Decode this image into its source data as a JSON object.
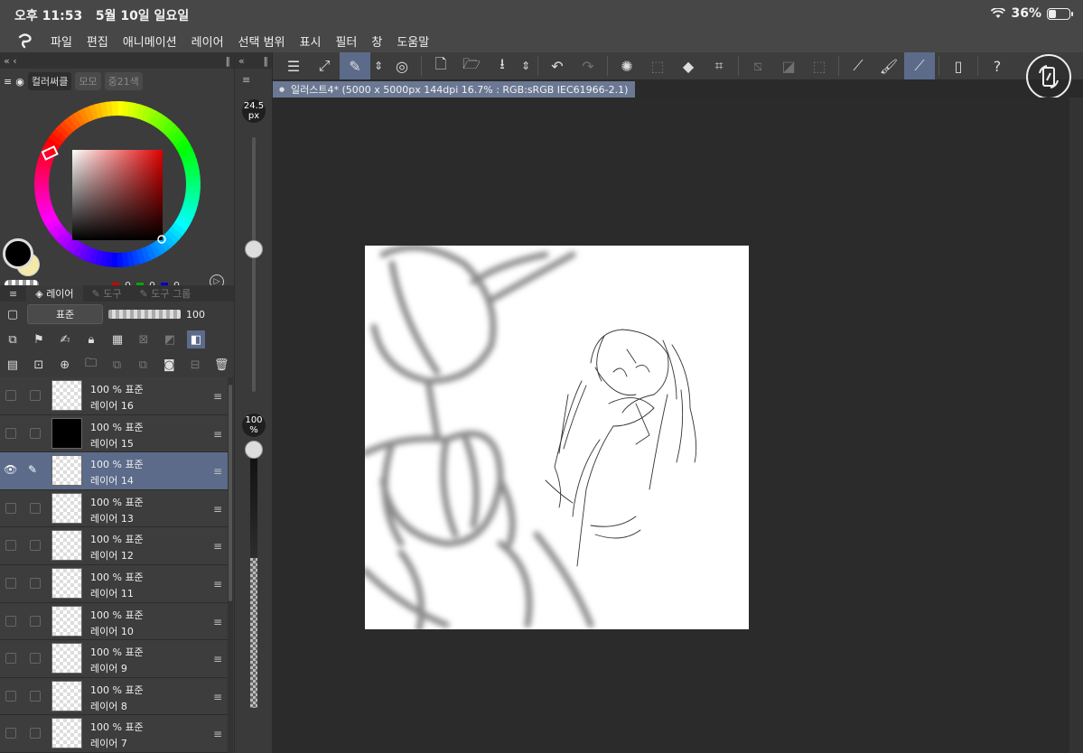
{
  "status": {
    "time": "오후 11:53",
    "date": "5월 10일 일요일",
    "battery_text": "36%",
    "battery_level": 0.36
  },
  "menu": {
    "items": [
      "파일",
      "편집",
      "애니메이션",
      "레이어",
      "선택 범위",
      "표시",
      "필터",
      "창",
      "도움말"
    ]
  },
  "color_panel": {
    "tabs": [
      "컬러써클",
      "모모",
      "중21색"
    ],
    "r": "0",
    "g": "0",
    "b": "0",
    "main_color": "#000000",
    "sub_color": "#f5e9a8"
  },
  "layer_panel": {
    "tabs": [
      "레이어",
      "도구",
      "도구 그룹"
    ],
    "blend_mode": "표준",
    "opacity": "100",
    "layers": [
      {
        "mode": "100 % 표준",
        "name": "레이어 16",
        "thumb": "checker",
        "selected": false,
        "visible_icons": false
      },
      {
        "mode": "100 % 표준",
        "name": "레이어 15",
        "thumb": "black",
        "selected": false,
        "visible_icons": false
      },
      {
        "mode": "100 % 표준",
        "name": "레이어 14",
        "thumb": "checker",
        "selected": true,
        "visible_icons": true
      },
      {
        "mode": "100 % 표준",
        "name": "레이어 13",
        "thumb": "checker",
        "selected": false,
        "visible_icons": false
      },
      {
        "mode": "100 % 표준",
        "name": "레이어 12",
        "thumb": "checker",
        "selected": false,
        "visible_icons": false
      },
      {
        "mode": "100 % 표준",
        "name": "레이어 11",
        "thumb": "checker",
        "selected": false,
        "visible_icons": false
      },
      {
        "mode": "100 % 표준",
        "name": "레이어 10",
        "thumb": "checker",
        "selected": false,
        "visible_icons": false
      },
      {
        "mode": "100 % 표준",
        "name": "레이어 9",
        "thumb": "checker",
        "selected": false,
        "visible_icons": false
      },
      {
        "mode": "100 % 표준",
        "name": "레이어 8",
        "thumb": "checker",
        "selected": false,
        "visible_icons": false
      },
      {
        "mode": "100 % 표준",
        "name": "레이어 7",
        "thumb": "checker",
        "selected": false,
        "visible_icons": false
      }
    ]
  },
  "brush": {
    "size": "24.5",
    "size_unit": "px",
    "opacity": "100",
    "opacity_unit": "%"
  },
  "document": {
    "tab_title": "일러스트4* (5000 x 5000px 144dpi 16.7% : RGB:sRGB IEC61966-2.1)"
  },
  "colors": {
    "accent": "#5c6b8a",
    "panel": "#3a3a3a",
    "canvas_bg": "#2b2b2b"
  }
}
